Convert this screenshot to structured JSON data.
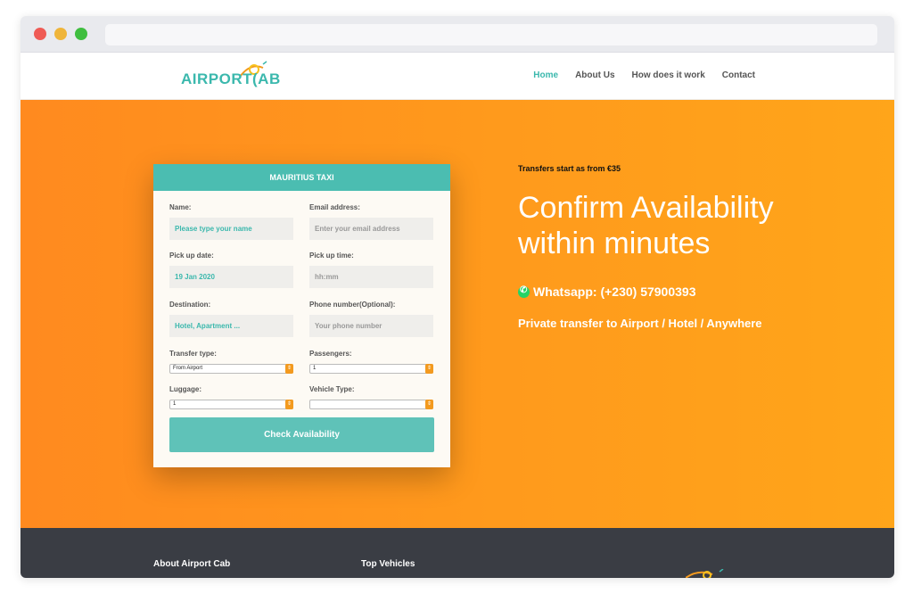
{
  "nav": {
    "logo_text": "AIRPORT",
    "logo_text2": "AB",
    "items": [
      {
        "label": "Home",
        "active": true
      },
      {
        "label": "About Us",
        "active": false
      },
      {
        "label": "How does it work",
        "active": false
      },
      {
        "label": "Contact",
        "active": false
      }
    ]
  },
  "form": {
    "title": "MAURITIUS TAXI",
    "name_label": "Name:",
    "name_placeholder": "Please type your name",
    "email_label": "Email address:",
    "email_placeholder": "Enter your email address",
    "pickup_date_label": "Pick up date:",
    "pickup_date_value": "19 Jan 2020",
    "pickup_time_label": "Pick up time:",
    "pickup_time_placeholder": "hh:mm",
    "destination_label": "Destination:",
    "destination_placeholder": "Hotel, Apartment ...",
    "phone_label": "Phone number(Optional):",
    "phone_placeholder": "Your phone number",
    "transfer_type_label": "Transfer type:",
    "transfer_type_value": "From Airport",
    "passengers_label": "Passengers:",
    "passengers_value": "1",
    "luggage_label": "Luggage:",
    "luggage_value": "1",
    "vehicle_type_label": "Vehicle Type:",
    "vehicle_type_value": "",
    "submit_label": "Check Availability"
  },
  "promo": {
    "small": "Transfers start as from €35",
    "headline_1": "Confirm Availability",
    "headline_2": "within minutes",
    "whatsapp": "Whatsapp: (+230) 57900393",
    "private": "Private transfer to Airport / Hotel / Anywhere"
  },
  "footer": {
    "about": "About Airport Cab",
    "vehicles": "Top Vehicles"
  },
  "colors": {
    "accent": "#4bbdb1",
    "hero_orange": "#ff9a1c",
    "footer_bg": "#3a3d44"
  }
}
